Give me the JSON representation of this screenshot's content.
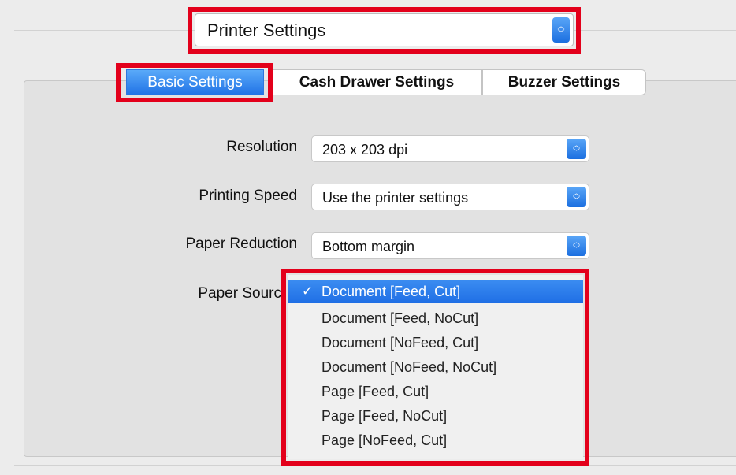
{
  "top_popup": {
    "label": "Printer Settings"
  },
  "tabs": [
    {
      "label": "Basic Settings",
      "active": true
    },
    {
      "label": "Cash Drawer Settings",
      "active": false
    },
    {
      "label": "Buzzer Settings",
      "active": false
    }
  ],
  "form": {
    "resolution": {
      "label": "Resolution",
      "value": "203 x 203 dpi"
    },
    "printing_speed": {
      "label": "Printing Speed",
      "value": "Use the printer settings"
    },
    "paper_reduction": {
      "label": "Paper Reduction",
      "value": "Bottom margin"
    },
    "paper_source": {
      "label": "Paper Sourc"
    }
  },
  "paper_source_menu": {
    "checkmark": "✓",
    "selected_index": 0,
    "options": [
      "Document [Feed, Cut]",
      "Document [Feed, NoCut]",
      "Document [NoFeed, Cut]",
      "Document [NoFeed, NoCut]",
      "Page [Feed, Cut]",
      "Page [Feed, NoCut]",
      "Page [NoFeed, Cut]"
    ]
  },
  "icons": {
    "popup_arrows": "up-down-chevron-icon",
    "check": "checkmark-icon"
  },
  "colors": {
    "highlight": "#e3001b",
    "accent": "#2173e6"
  }
}
